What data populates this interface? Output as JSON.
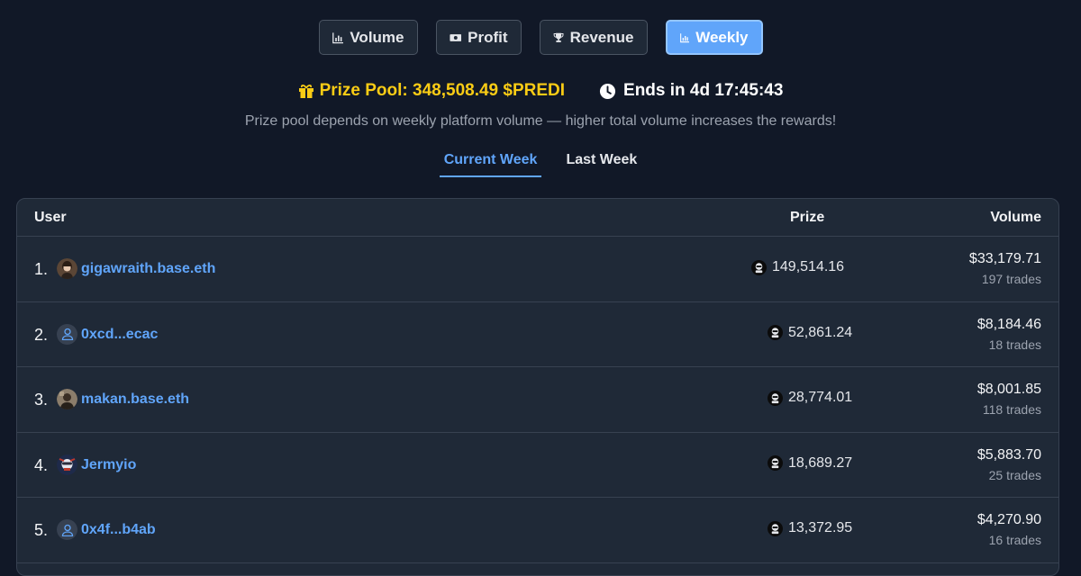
{
  "nav": {
    "volume": "Volume",
    "profit": "Profit",
    "revenue": "Revenue",
    "weekly": "Weekly",
    "active": "Weekly"
  },
  "prize_pool": {
    "label": "Prize Pool: 348,508.49 $PREDI",
    "ends": "Ends in 4d 17:45:43",
    "note": "Prize pool depends on weekly platform volume — higher total volume increases the rewards!"
  },
  "tabs": {
    "current": "Current Week",
    "last": "Last Week",
    "active": "Current Week"
  },
  "table": {
    "headers": {
      "user": "User",
      "prize": "Prize",
      "volume": "Volume"
    },
    "rows": [
      {
        "rank": "1.",
        "user": "gigawraith.base.eth",
        "avatar": "photo-avatar",
        "prize": "149,514.16",
        "volume": "$33,179.71",
        "trades": "197 trades"
      },
      {
        "rank": "2.",
        "user": "0xcd...ecac",
        "avatar": "user-icon",
        "prize": "52,861.24",
        "volume": "$8,184.46",
        "trades": "18 trades"
      },
      {
        "rank": "3.",
        "user": "makan.base.eth",
        "avatar": "photo-avatar",
        "prize": "28,774.01",
        "volume": "$8,001.85",
        "trades": "118 trades"
      },
      {
        "rank": "4.",
        "user": "Jermyio",
        "avatar": "photo-avatar",
        "prize": "18,689.27",
        "volume": "$5,883.70",
        "trades": "25 trades"
      },
      {
        "rank": "5.",
        "user": "0x4f...b4ab",
        "avatar": "user-icon",
        "prize": "13,372.95",
        "volume": "$4,270.90",
        "trades": "16 trades"
      }
    ]
  },
  "colors": {
    "background": "#111827",
    "accent": "#60a5fa",
    "prize_gold": "#facc15",
    "panel": "#1f2937"
  }
}
